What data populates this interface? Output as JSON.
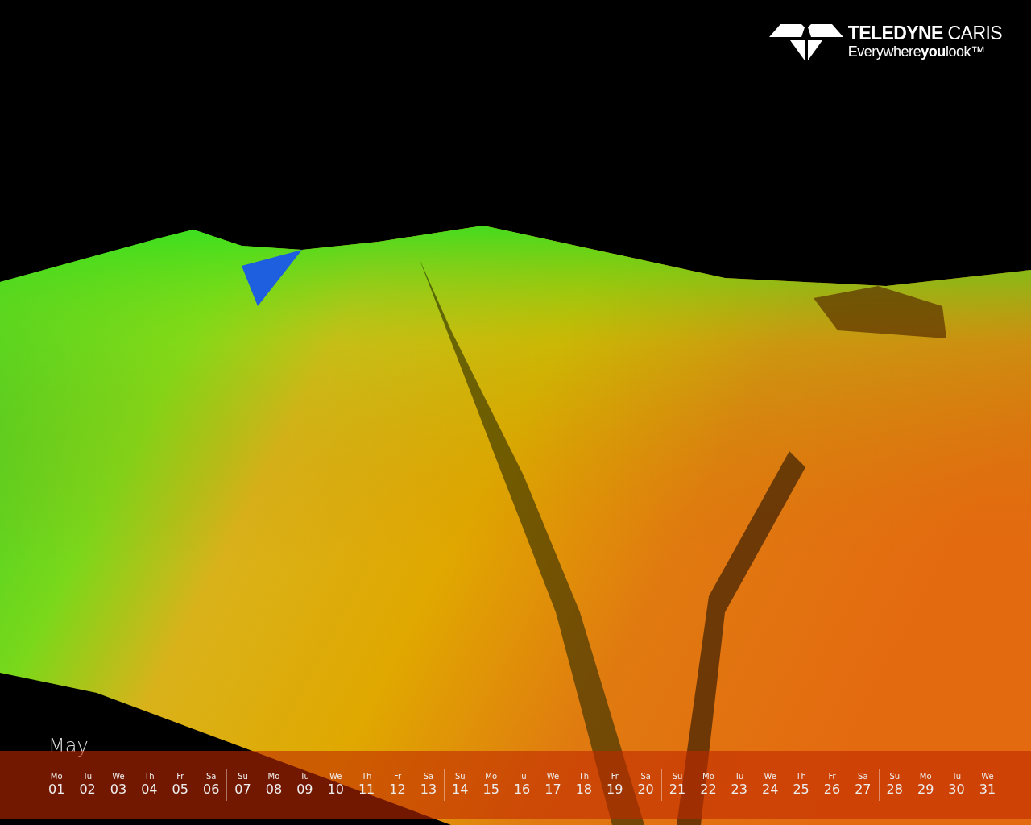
{
  "logo": {
    "name": "**TELEDYNE** CARIS",
    "tagline": "Everywhere**you**look™"
  },
  "calendar": {
    "month": "May",
    "weeks": [
      {
        "days": [
          {
            "weekday": "Mo",
            "date": "01"
          },
          {
            "weekday": "Tu",
            "date": "02"
          },
          {
            "weekday": "We",
            "date": "03"
          },
          {
            "weekday": "Th",
            "date": "04"
          },
          {
            "weekday": "Fr",
            "date": "05"
          },
          {
            "weekday": "Sa",
            "date": "06"
          }
        ]
      },
      {
        "days": [
          {
            "weekday": "Su",
            "date": "07"
          },
          {
            "weekday": "Mo",
            "date": "08"
          },
          {
            "weekday": "Tu",
            "date": "09"
          },
          {
            "weekday": "We",
            "date": "10"
          },
          {
            "weekday": "Th",
            "date": "11"
          },
          {
            "weekday": "Fr",
            "date": "12"
          },
          {
            "weekday": "Sa",
            "date": "13"
          }
        ]
      },
      {
        "days": [
          {
            "weekday": "Su",
            "date": "14"
          },
          {
            "weekday": "Mo",
            "date": "15"
          },
          {
            "weekday": "Tu",
            "date": "16"
          },
          {
            "weekday": "We",
            "date": "17"
          },
          {
            "weekday": "Th",
            "date": "18"
          },
          {
            "weekday": "Fr",
            "date": "19"
          },
          {
            "weekday": "Sa",
            "date": "20"
          }
        ]
      },
      {
        "days": [
          {
            "weekday": "Su",
            "date": "21"
          },
          {
            "weekday": "Mo",
            "date": "22"
          },
          {
            "weekday": "Tu",
            "date": "23"
          },
          {
            "weekday": "We",
            "date": "24"
          },
          {
            "weekday": "Th",
            "date": "25"
          },
          {
            "weekday": "Fr",
            "date": "26"
          },
          {
            "weekday": "Sa",
            "date": "27"
          }
        ]
      },
      {
        "days": [
          {
            "weekday": "Su",
            "date": "28"
          },
          {
            "weekday": "Mo",
            "date": "29"
          },
          {
            "weekday": "Tu",
            "date": "30"
          },
          {
            "weekday": "We",
            "date": "31"
          }
        ]
      }
    ]
  }
}
